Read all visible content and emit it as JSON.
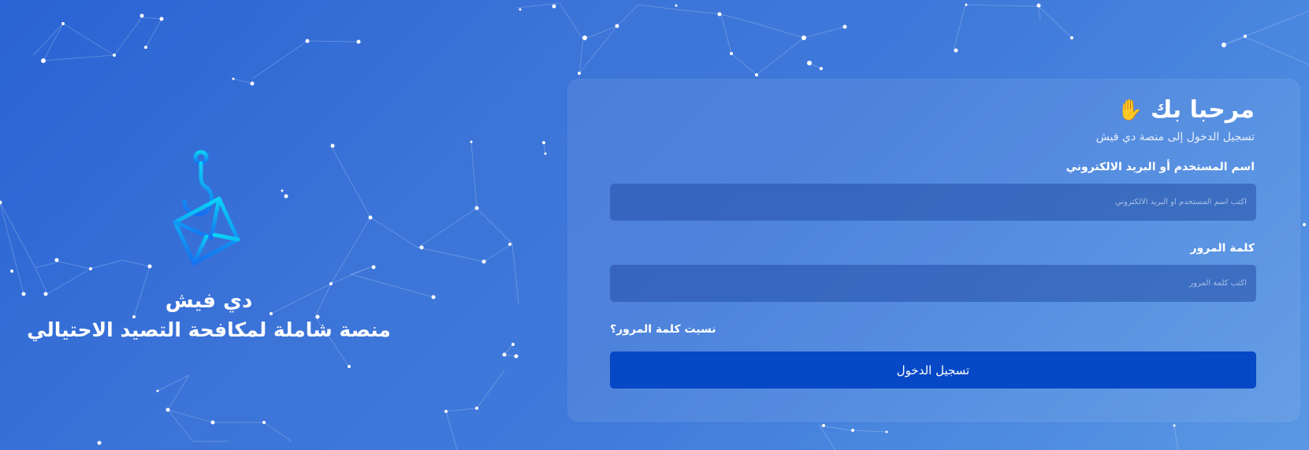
{
  "brand": {
    "name": "دي فيش",
    "tagline": "منصة شاملة لمكافحة التصيد الاحتيالي"
  },
  "login": {
    "welcome": "مرحبا بك",
    "wave_icon": "waving-hand-icon",
    "subtitle": "تسجيل الدخول إلى منصة دي فيش",
    "username_label": "اسم المستخدم أو البريد الالكتروني",
    "username_placeholder": "اكتب اسم المستخدم أو البريد الالكتروني",
    "password_label": "كلمة المرور",
    "password_placeholder": "اكتب كلمة المرور",
    "forgot_password": "نسيت كلمة المرور؟",
    "submit_label": "تسجيل الدخول"
  },
  "colors": {
    "background_primary": "#2a63d3",
    "background_secondary": "#5b97e3",
    "button": "#0648c6",
    "logo_gradient_start": "#0bd2f5",
    "logo_gradient_end": "#1470f2"
  }
}
